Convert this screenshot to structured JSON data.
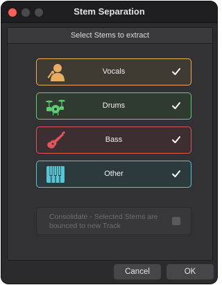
{
  "window": {
    "title": "Stem Separation"
  },
  "panel": {
    "header": "Select Stems to extract"
  },
  "stems": [
    {
      "label": "Vocals",
      "icon": "vocalist-icon",
      "checked": true,
      "color": "#e9ad62"
    },
    {
      "label": "Drums",
      "icon": "drum-kit-icon",
      "checked": true,
      "color": "#5fcd74"
    },
    {
      "label": "Bass",
      "icon": "guitar-icon",
      "checked": true,
      "color": "#e0545c"
    },
    {
      "label": "Other",
      "icon": "keyboard-icon",
      "checked": true,
      "color": "#56c6d6"
    }
  ],
  "consolidate": {
    "label": "Consolidate - Selected Stems are bounced to new Track",
    "checked": false,
    "enabled": false
  },
  "buttons": {
    "cancel": "Cancel",
    "ok": "OK"
  }
}
